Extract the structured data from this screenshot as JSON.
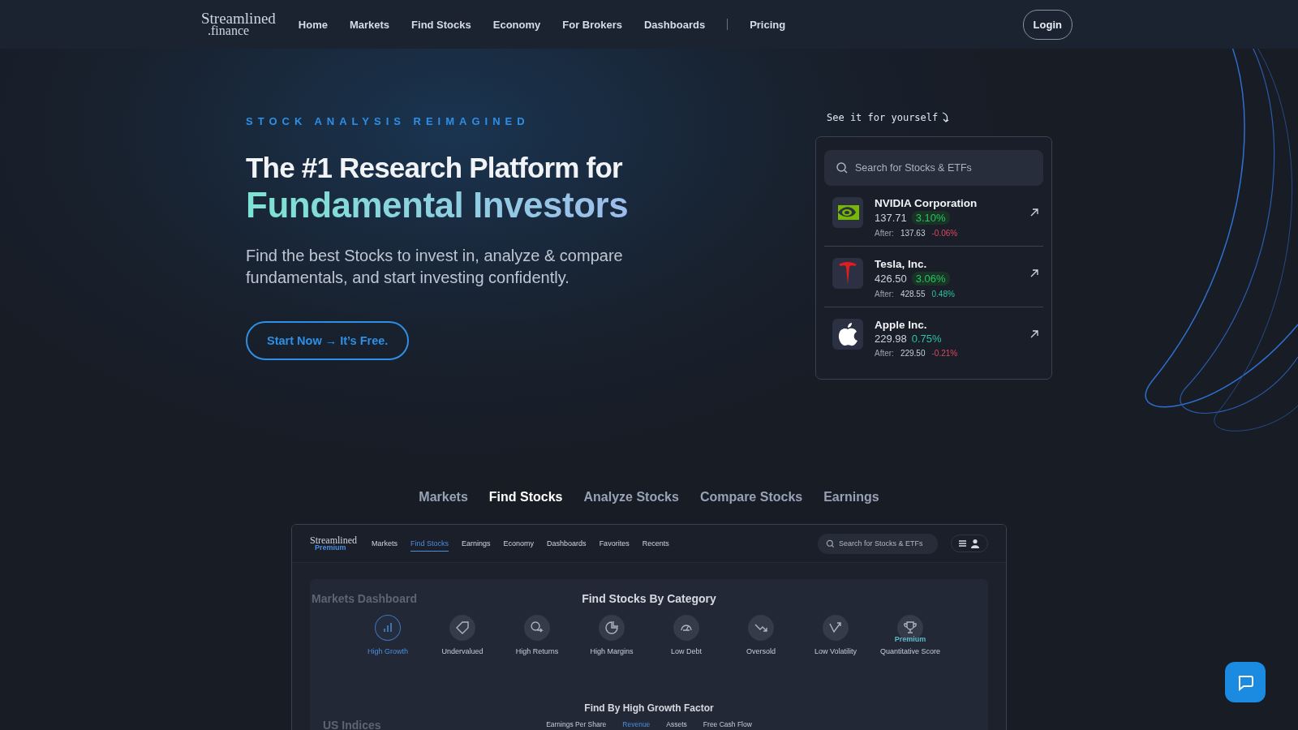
{
  "nav": {
    "logo": {
      "top": "Streamlined",
      "bottom": ".finance"
    },
    "links": [
      {
        "label": "Home"
      },
      {
        "label": "Markets"
      },
      {
        "label": "Find Stocks"
      },
      {
        "label": "Economy"
      },
      {
        "label": "For Brokers"
      },
      {
        "label": "Dashboards"
      },
      {
        "label": "Pricing"
      }
    ],
    "login": "Login"
  },
  "hero": {
    "eyebrow": "STOCK ANALYSIS REIMAGINED",
    "title_line1": "The #1 Research Platform for",
    "title_line2": "Fundamental Investors",
    "subtitle": "Find the best Stocks to invest in, analyze & compare fundamentals, and start investing confidently.",
    "cta": "Start Now → It’s Free."
  },
  "demo": {
    "hint": "See it for yourself",
    "search": {
      "placeholder": "Search for Stocks & ETFs"
    },
    "stocks": [
      {
        "name": "NVIDIA Corporation",
        "price": "137.71",
        "change": {
          "text": "3.10%",
          "kind": "up_pill"
        },
        "after_label": "After:",
        "after_price": "137.63",
        "after_change": {
          "text": "-0.06%",
          "kind": "down"
        }
      },
      {
        "name": "Tesla, Inc.",
        "price": "426.50",
        "change": {
          "text": "3.06%",
          "kind": "up_pill"
        },
        "after_label": "After:",
        "after_price": "428.55",
        "after_change": {
          "text": "0.48%",
          "kind": "up"
        }
      },
      {
        "name": "Apple Inc.",
        "price": "229.98",
        "change": {
          "text": "0.75%",
          "kind": "up"
        },
        "after_label": "After:",
        "after_price": "229.50",
        "after_change": {
          "text": "-0.21%",
          "kind": "down"
        }
      }
    ]
  },
  "feature_tabs": [
    {
      "label": "Markets",
      "selected": false
    },
    {
      "label": "Find Stocks",
      "selected": true
    },
    {
      "label": "Analyze Stocks",
      "selected": false
    },
    {
      "label": "Compare Stocks",
      "selected": false
    },
    {
      "label": "Earnings",
      "selected": false
    }
  ],
  "preview": {
    "logo": {
      "top": "Streamlined",
      "bottom": "Premium"
    },
    "nav": [
      {
        "label": "Markets",
        "selected": false
      },
      {
        "label": "Find Stocks",
        "selected": true
      },
      {
        "label": "Earnings",
        "selected": false
      },
      {
        "label": "Economy",
        "selected": false
      },
      {
        "label": "Dashboards",
        "selected": false
      },
      {
        "label": "Favorites",
        "selected": false
      },
      {
        "label": "Recents",
        "selected": false
      }
    ],
    "search": {
      "placeholder": "Search for Stocks & ETFs"
    },
    "background": {
      "title": "Markets Dashboard",
      "section": "US Indices"
    },
    "category_title": "Find Stocks By Category",
    "categories": [
      {
        "label": "High Growth",
        "selected": true
      },
      {
        "label": "Undervalued",
        "selected": false
      },
      {
        "label": "High Returns",
        "selected": false
      },
      {
        "label": "High Margins",
        "selected": false
      },
      {
        "label": "Low Debt",
        "selected": false
      },
      {
        "label": "Oversold",
        "selected": false
      },
      {
        "label": "Low Volatility",
        "selected": false
      },
      {
        "label": "Quantitative Score",
        "selected": false,
        "badge": "Premium"
      }
    ],
    "factor_title": "Find By High Growth Factor",
    "factors": [
      {
        "label": "Earnings Per Share",
        "selected": false
      },
      {
        "label": "Revenue",
        "selected": true
      },
      {
        "label": "Assets",
        "selected": false
      },
      {
        "label": "Free Cash Flow",
        "selected": false
      }
    ]
  }
}
